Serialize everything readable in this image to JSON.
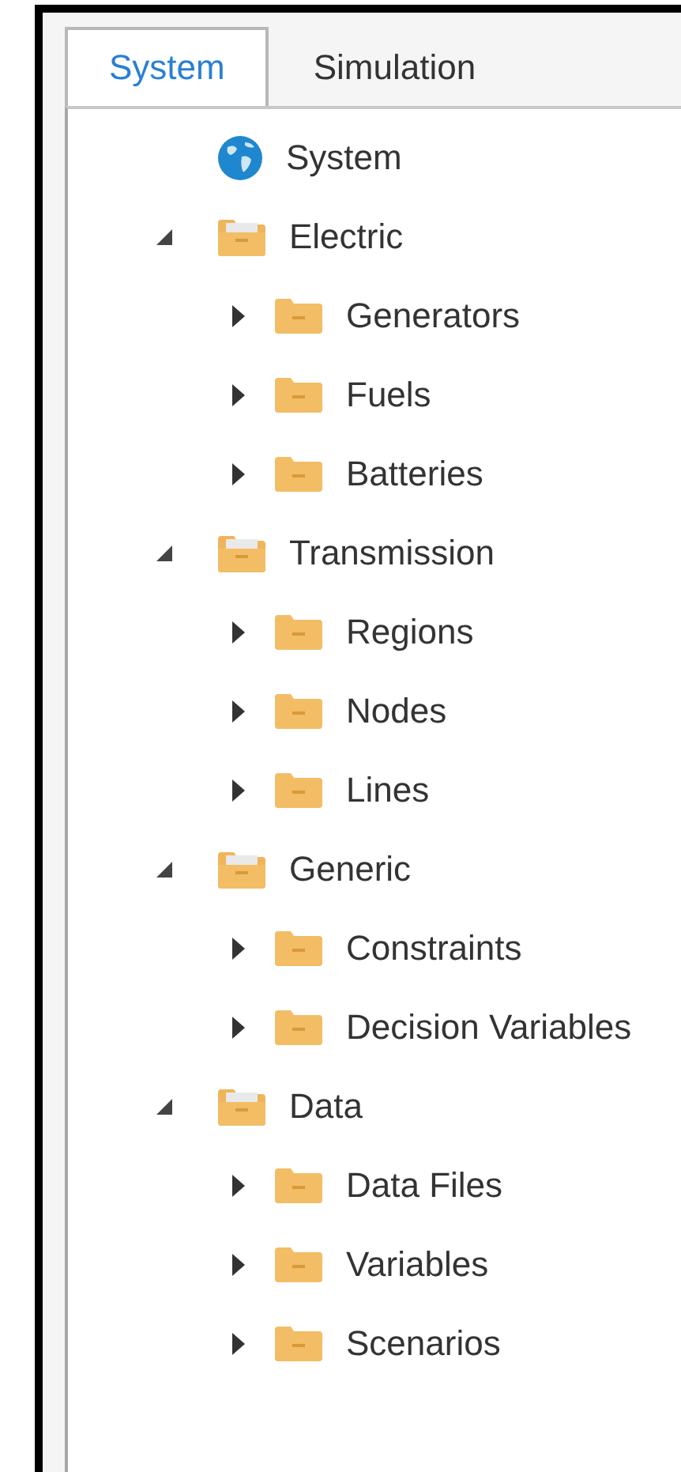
{
  "tabs": [
    {
      "label": "System",
      "selected": true
    },
    {
      "label": "Simulation",
      "selected": false
    }
  ],
  "tree": [
    {
      "kind": "globe",
      "label": "System"
    },
    {
      "kind": "folder",
      "label": "Electric",
      "expanded": true,
      "children": [
        {
          "kind": "folder",
          "label": "Generators",
          "expanded": false
        },
        {
          "kind": "folder",
          "label": "Fuels",
          "expanded": false
        },
        {
          "kind": "folder",
          "label": "Batteries",
          "expanded": false
        }
      ]
    },
    {
      "kind": "folder",
      "label": "Transmission",
      "expanded": true,
      "children": [
        {
          "kind": "folder",
          "label": "Regions",
          "expanded": false
        },
        {
          "kind": "folder",
          "label": "Nodes",
          "expanded": false
        },
        {
          "kind": "folder",
          "label": "Lines",
          "expanded": false
        }
      ]
    },
    {
      "kind": "folder",
      "label": "Generic",
      "expanded": true,
      "children": [
        {
          "kind": "folder",
          "label": "Constraints",
          "expanded": false
        },
        {
          "kind": "folder",
          "label": "Decision Variables",
          "expanded": false
        }
      ]
    },
    {
      "kind": "folder",
      "label": "Data",
      "expanded": true,
      "children": [
        {
          "kind": "folder",
          "label": "Data Files",
          "expanded": false
        },
        {
          "kind": "folder",
          "label": "Variables",
          "expanded": false
        },
        {
          "kind": "folder",
          "label": "Scenarios",
          "expanded": false
        }
      ]
    }
  ]
}
